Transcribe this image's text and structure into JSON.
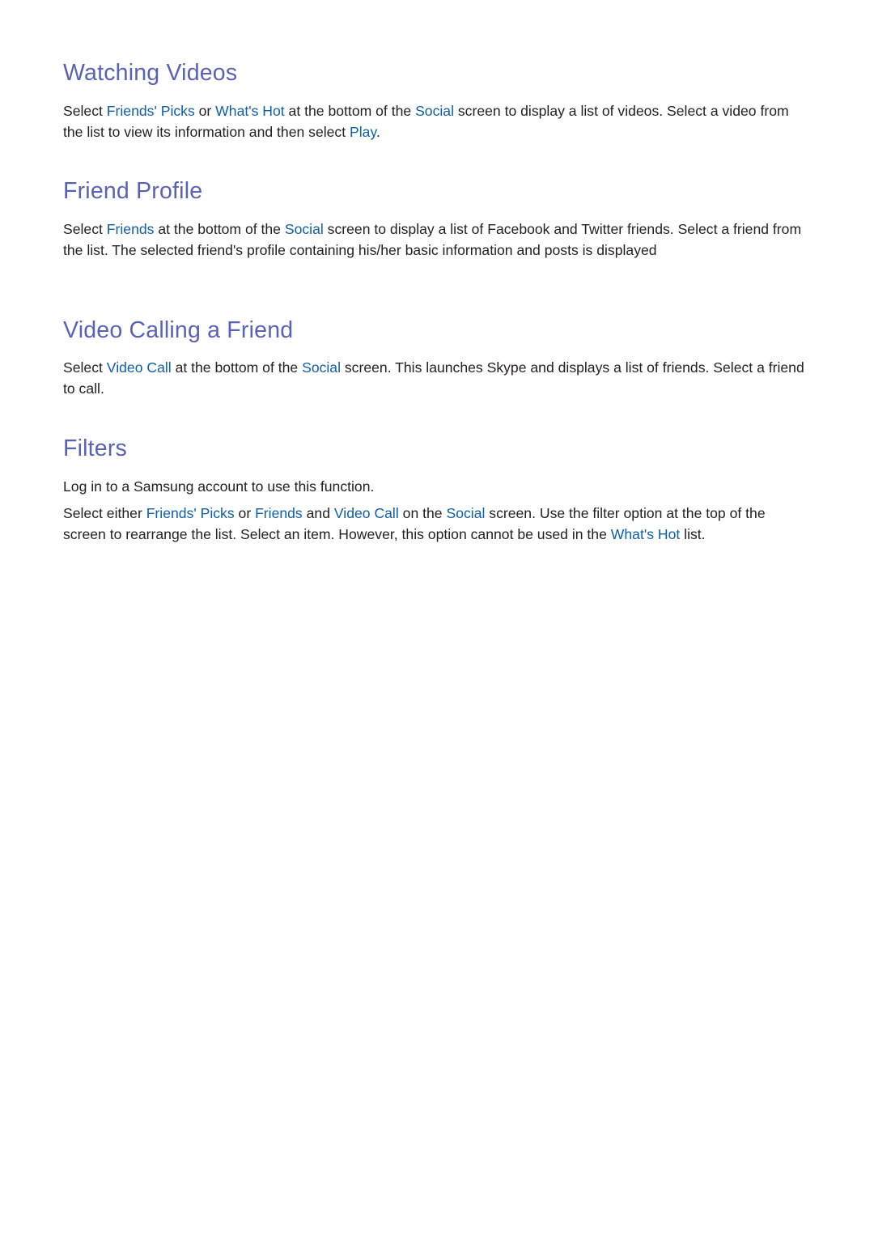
{
  "sections": [
    {
      "heading": "Watching Videos",
      "paragraphs": [
        {
          "parts": [
            {
              "t": "Select ",
              "link": false
            },
            {
              "t": "Friends' Picks",
              "link": true
            },
            {
              "t": " or ",
              "link": false
            },
            {
              "t": "What's Hot",
              "link": true
            },
            {
              "t": " at the bottom of the ",
              "link": false
            },
            {
              "t": "Social",
              "link": true
            },
            {
              "t": " screen to display a list of videos. Select a video from the list to view its information and then select ",
              "link": false
            },
            {
              "t": "Play",
              "link": true
            },
            {
              "t": ".",
              "link": false
            }
          ]
        }
      ]
    },
    {
      "heading": "Friend Profile",
      "paragraphs": [
        {
          "parts": [
            {
              "t": "Select ",
              "link": false
            },
            {
              "t": "Friends",
              "link": true
            },
            {
              "t": " at the bottom of the ",
              "link": false
            },
            {
              "t": "Social",
              "link": true
            },
            {
              "t": " screen to display a list of Facebook and Twitter friends. Select a friend from the list. The selected friend's profile containing his/her basic information and posts is displayed",
              "link": false
            }
          ]
        }
      ]
    },
    {
      "heading": "Video Calling a Friend",
      "paragraphs": [
        {
          "parts": [
            {
              "t": "Select ",
              "link": false
            },
            {
              "t": "Video Call",
              "link": true
            },
            {
              "t": " at the bottom of the ",
              "link": false
            },
            {
              "t": "Social",
              "link": true
            },
            {
              "t": " screen. This launches Skype and displays a list of friends. Select a friend to call.",
              "link": false
            }
          ]
        }
      ]
    },
    {
      "heading": "Filters",
      "paragraphs": [
        {
          "parts": [
            {
              "t": "Log in to a Samsung account to use this function.",
              "link": false
            }
          ]
        },
        {
          "parts": [
            {
              "t": "Select either ",
              "link": false
            },
            {
              "t": "Friends' Picks",
              "link": true
            },
            {
              "t": " or ",
              "link": false
            },
            {
              "t": "Friends",
              "link": true
            },
            {
              "t": " and ",
              "link": false
            },
            {
              "t": "Video Call",
              "link": true
            },
            {
              "t": " on the ",
              "link": false
            },
            {
              "t": "Social",
              "link": true
            },
            {
              "t": " screen. Use the filter option at the top of the screen to rearrange the list. Select an item. However, this option cannot be used in the ",
              "link": false
            },
            {
              "t": "What's Hot",
              "link": true
            },
            {
              "t": " list.",
              "link": false
            }
          ]
        }
      ]
    }
  ]
}
